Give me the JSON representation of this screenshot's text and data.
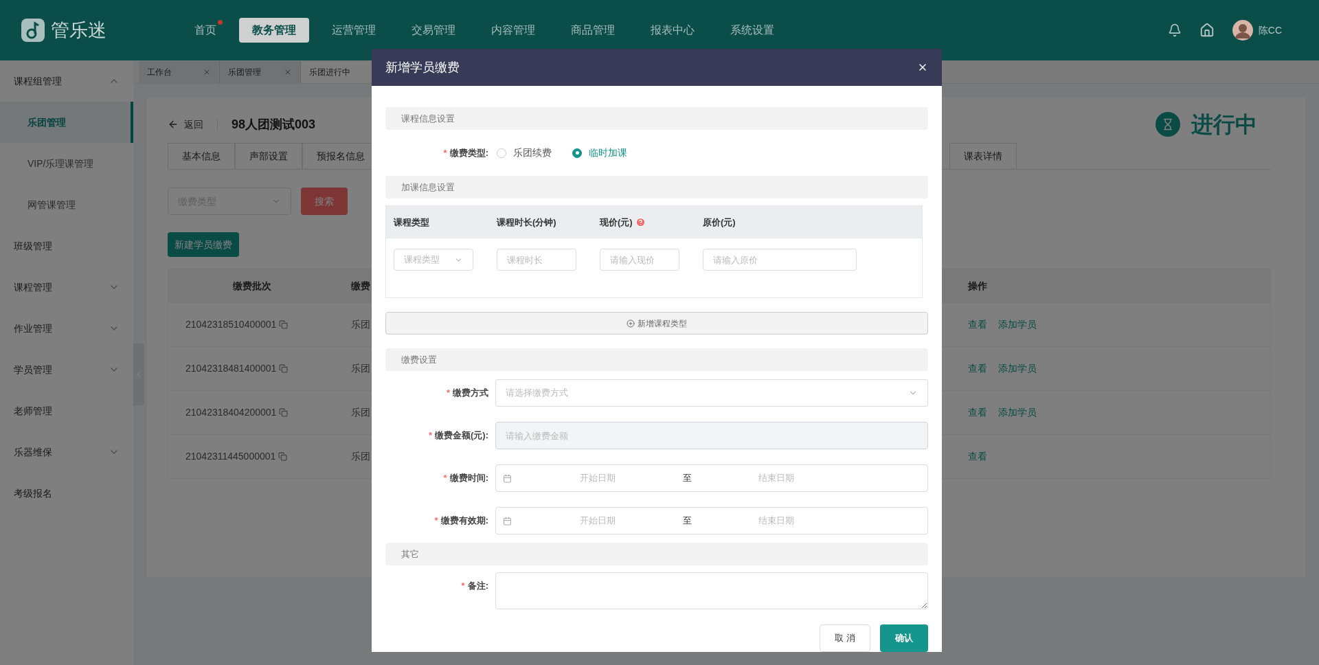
{
  "header": {
    "logo": "管乐迷",
    "nav": [
      {
        "label": "首页",
        "selected": false,
        "dot": true
      },
      {
        "label": "教务管理",
        "selected": true,
        "dot": false
      },
      {
        "label": "运营管理",
        "selected": false,
        "dot": false
      },
      {
        "label": "交易管理",
        "selected": false,
        "dot": false
      },
      {
        "label": "内容管理",
        "selected": false,
        "dot": false
      },
      {
        "label": "商品管理",
        "selected": false,
        "dot": false
      },
      {
        "label": "报表中心",
        "selected": false,
        "dot": false
      },
      {
        "label": "系统设置",
        "selected": false,
        "dot": false
      }
    ],
    "user": "陈CC"
  },
  "sidebar": {
    "items": [
      {
        "label": "课程组管理",
        "expanded": true,
        "children": [
          {
            "label": "乐团管理",
            "selected": true
          },
          {
            "label": "VIP/乐理课管理",
            "selected": false
          },
          {
            "label": "网管课管理",
            "selected": false
          }
        ]
      },
      {
        "label": "班级管理"
      },
      {
        "label": "课程管理",
        "expanded": false
      },
      {
        "label": "作业管理",
        "expanded": false
      },
      {
        "label": "学员管理",
        "expanded": false
      },
      {
        "label": "老师管理"
      },
      {
        "label": "乐器维保",
        "expanded": false
      },
      {
        "label": "考级报名"
      }
    ]
  },
  "page_tabs": [
    {
      "label": "工作台",
      "selected": false,
      "closable": true
    },
    {
      "label": "乐团管理",
      "selected": false,
      "closable": true
    },
    {
      "label": "乐团进行中",
      "selected": true,
      "closable": false
    }
  ],
  "content": {
    "back": "返回",
    "title": "98人团测试003",
    "status": "进行中",
    "tabs": [
      {
        "label": "基本信息",
        "selected": false
      },
      {
        "label": "声部设置",
        "selected": false
      },
      {
        "label": "预报名信息",
        "selected": false
      },
      {
        "label": "课表详情",
        "selected": false
      }
    ],
    "filter": {
      "placeholder": "缴费类型",
      "search_button": "搜索"
    },
    "new_button": "新建学员缴费",
    "table": {
      "columns": [
        "缴费批次",
        "缴费",
        "操作"
      ],
      "rows": [
        {
          "batch": "21042318510400001",
          "column_2": "乐团",
          "actions": [
            "查看",
            "添加学员"
          ]
        },
        {
          "batch": "21042318481400001",
          "column_2": "乐团",
          "actions": [
            "查看",
            "添加学员"
          ]
        },
        {
          "batch": "21042318404200001",
          "column_2": "乐团",
          "actions": [
            "查看",
            "添加学员"
          ]
        },
        {
          "batch": "21042311445000001",
          "column_2": "乐团",
          "actions": [
            "查看"
          ]
        }
      ]
    }
  },
  "modal": {
    "title": "新增学员缴费",
    "section_course": "课程信息设置",
    "payment_type": {
      "label": "缴费类型:",
      "required_mark": "*",
      "options": [
        {
          "label": "乐团续费",
          "selected": false
        },
        {
          "label": "临时加课",
          "selected": true
        }
      ]
    },
    "section_extra": "加课信息设置",
    "course_table": {
      "columns": [
        {
          "label": "课程类型",
          "help": false
        },
        {
          "label": "课程时长(分钟)",
          "help": false
        },
        {
          "label": "现价(元)",
          "help": true
        },
        {
          "label": "原价(元)",
          "help": false
        }
      ],
      "row": [
        {
          "kind": "select",
          "placeholder": "课程类型"
        },
        {
          "kind": "input",
          "placeholder": "课程时长"
        },
        {
          "kind": "input",
          "placeholder": "请输入现价"
        },
        {
          "kind": "input",
          "placeholder": "请输入原价"
        }
      ]
    },
    "add_course_type": "新增课程类型",
    "section_payment": "缴费设置",
    "fields": [
      {
        "kind": "select",
        "label": "缴费方式",
        "required_mark": "*",
        "placeholder": "请选择缴费方式",
        "disabled": false
      },
      {
        "kind": "input",
        "label": "缴费金额(元):",
        "required_mark": "*",
        "placeholder": "请输入缴费金额",
        "disabled": true
      },
      {
        "kind": "daterange",
        "label": "缴费时间:",
        "required_mark": "*",
        "start": "开始日期",
        "separator": "至",
        "end": "结束日期",
        "disabled": false
      },
      {
        "kind": "daterange",
        "label": "缴费有效期:",
        "required_mark": "*",
        "start": "开始日期",
        "separator": "至",
        "end": "结束日期",
        "disabled": false
      }
    ],
    "section_other": "其它",
    "remark": {
      "label": "备注:",
      "required_mark": "*"
    },
    "buttons": [
      {
        "kind": "secondary",
        "label": "取 消"
      },
      {
        "kind": "primary",
        "label": "确认"
      }
    ]
  }
}
